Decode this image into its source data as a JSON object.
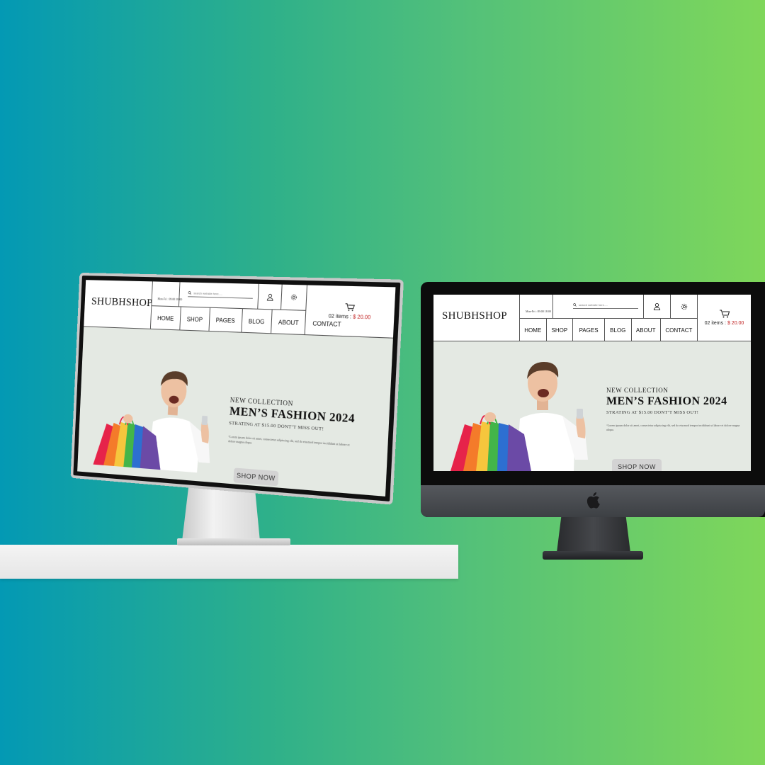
{
  "site": {
    "logo": "SHUBHSHOP",
    "store_hours": "Mon-Fri : 09:00 18:00",
    "search_placeholder": "search website here.....",
    "cart_count": "02 items :",
    "cart_total": "$ 20.00",
    "nav": [
      "HOME",
      "SHOP",
      "PAGES",
      "BLOG",
      "ABOUT",
      "CONTACT"
    ],
    "hero": {
      "kicker": "NEW COLLECTION",
      "headline": "MEN’S FASHION 2024",
      "subline": "STRATING  AT $15.00 DONT’T MISS OUT!",
      "body": "“Lorem ipsum dolor sit amet, consectetur adipiscing elit, sed do eiusmod tempor incididunt ut labore et dolore magna aliqua.",
      "cta": "SHOP NOW"
    }
  },
  "colors": {
    "bg_gradient_start": "#0399b4",
    "bg_gradient_end": "#7fd75a",
    "hero_bg": "#e4e9e3",
    "price_red": "#c02020",
    "header_bg": "#ffffff"
  },
  "icons": [
    "clock-icon",
    "search-icon",
    "user-icon",
    "settings-icon",
    "cart-icon",
    "apple-logo-icon"
  ]
}
